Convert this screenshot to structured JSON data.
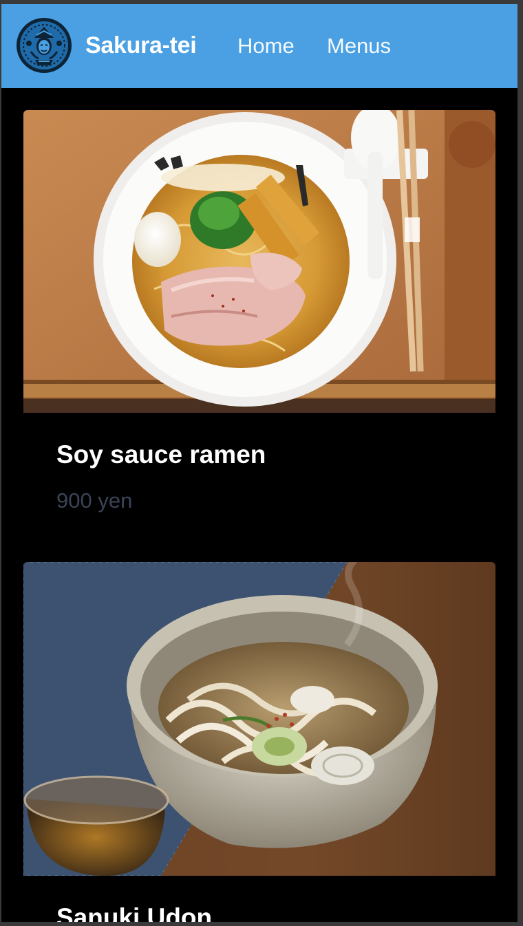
{
  "header": {
    "brand": "Sakura-tei",
    "nav": [
      {
        "label": "Home"
      },
      {
        "label": "Menus"
      }
    ]
  },
  "menu_items": [
    {
      "name": "Soy sauce ramen",
      "price": "900 yen",
      "image": "ramen-bowl-photo"
    },
    {
      "name": "Sanuki Udon",
      "image": "udon-bowl-photo"
    }
  ],
  "colors": {
    "navbar": "#4aa0e2",
    "page_background": "#000000",
    "price_text": "#3b4456"
  }
}
